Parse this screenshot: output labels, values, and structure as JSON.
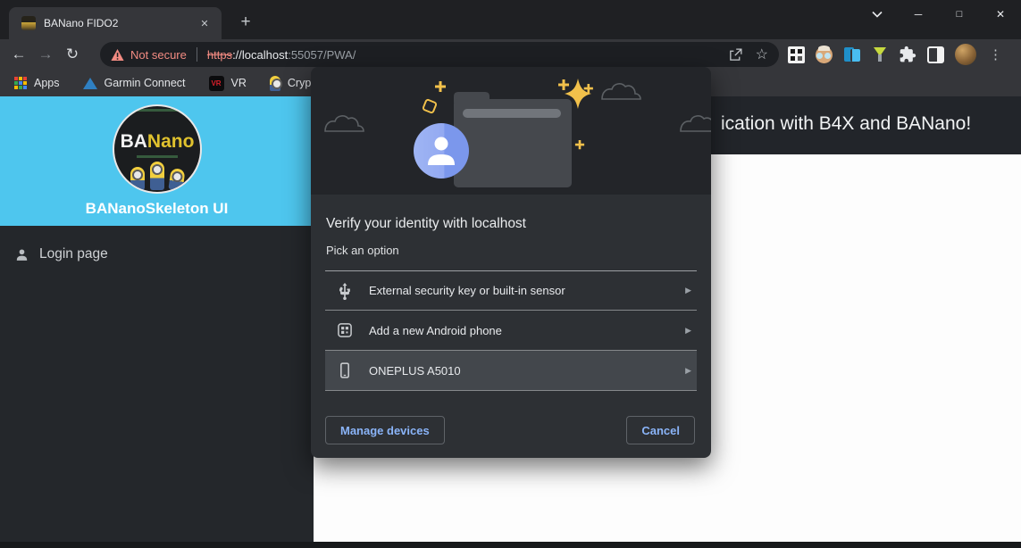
{
  "tab": {
    "title": "BANano FIDO2"
  },
  "icons": {
    "back": "←",
    "forward": "→",
    "reload": "↻",
    "star": "☆",
    "kebab": "⋮",
    "new_tab": "+",
    "tab_close": "✕",
    "win_min": "─",
    "win_max": "□",
    "win_close": "✕",
    "option_arrow": "▶",
    "vr_badge": "VR"
  },
  "url": {
    "warning": "Not secure",
    "scheme": "https",
    "sep": "://",
    "host": "localhost",
    "rest": ":55057/PWA/"
  },
  "bookmarks": {
    "apps": "Apps",
    "garmin": "Garmin Connect",
    "vr": "VR",
    "crypto": "Crypto Ove"
  },
  "sidebar": {
    "logo_ba": "BA",
    "logo_nano": "Nano",
    "title": "BANanoSkeleton UI",
    "login": "Login page"
  },
  "main": {
    "header_visible_text": "ication with B4X and BANano!"
  },
  "dialog": {
    "title": "Verify your identity with localhost",
    "subtitle": "Pick an option",
    "options": [
      {
        "label": "External security key or built-in sensor",
        "icon": "usb-icon",
        "highlighted": false
      },
      {
        "label": "Add a new Android phone",
        "icon": "android-phone-add-icon",
        "highlighted": false
      },
      {
        "label": "ONEPLUS A5010",
        "icon": "phone-icon",
        "highlighted": true
      }
    ],
    "manage_button": "Manage devices",
    "cancel_button": "Cancel"
  },
  "colors": {
    "accent_blue": "#8ab4f8",
    "brand_cyan": "#4ec6ee",
    "warning_red": "#f28b82",
    "dialog_bg": "#2d3034",
    "banner_bg": "#232529",
    "highlight_row": "#43474c"
  }
}
